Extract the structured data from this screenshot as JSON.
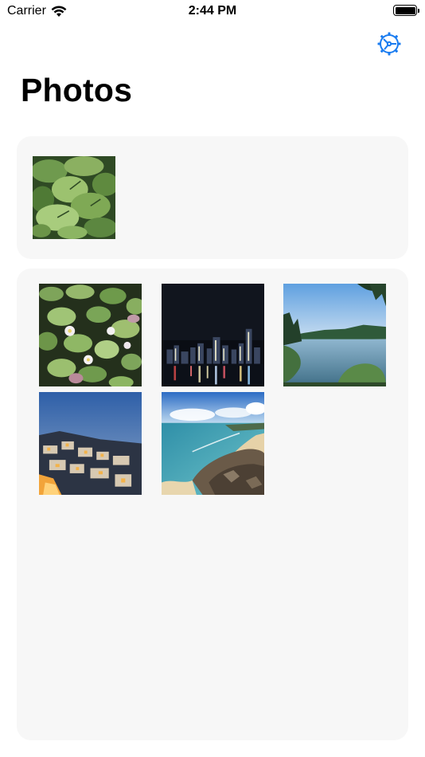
{
  "status_bar": {
    "carrier": "Carrier",
    "time": "2:44 PM",
    "battery_level": 1.0
  },
  "header": {
    "title": "Photos",
    "settings_icon": "gear-icon",
    "accent_color": "#1a7cf0"
  },
  "selected_photos": [
    {
      "subject": "lily pads"
    }
  ],
  "gallery_photos": [
    {
      "subject": "water lilies"
    },
    {
      "subject": "city skyline at night"
    },
    {
      "subject": "lake"
    },
    {
      "subject": "coastal town at dusk"
    },
    {
      "subject": "beach coastline"
    }
  ]
}
